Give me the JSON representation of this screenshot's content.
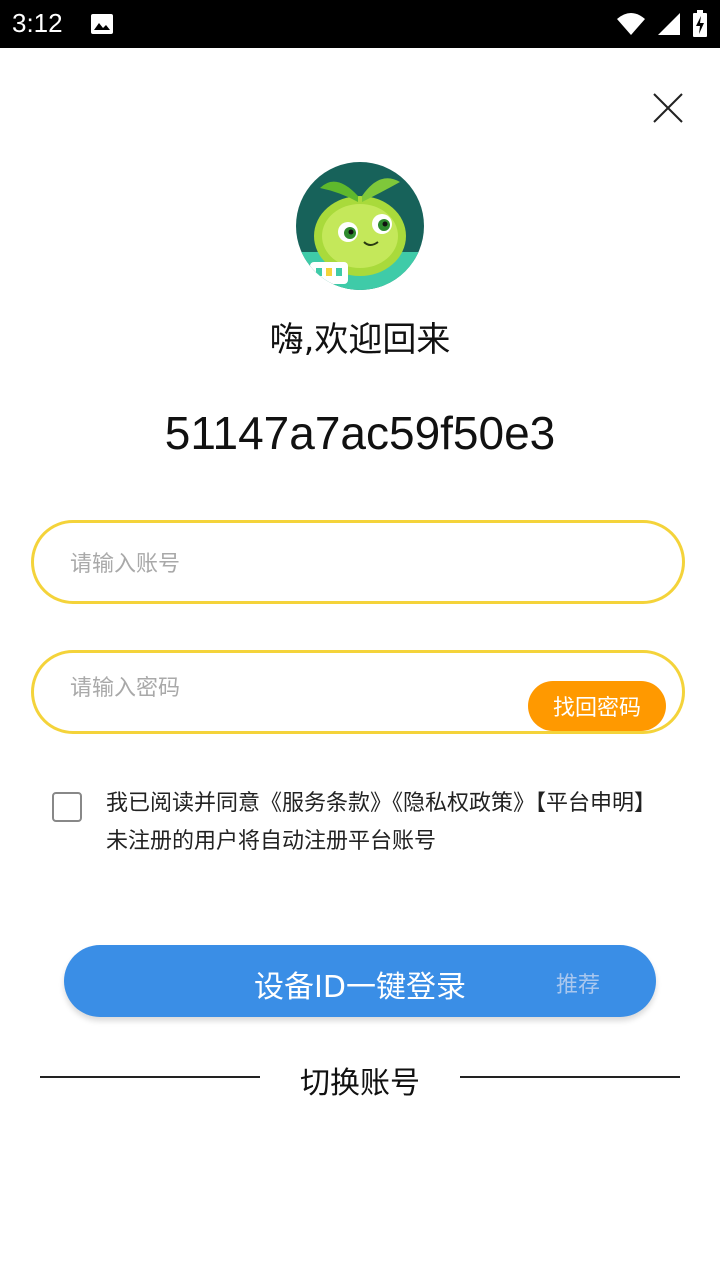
{
  "status_bar": {
    "time": "3:12"
  },
  "welcome": "嗨,欢迎回来",
  "device_id": "51147a7ac59f50e3",
  "account_field": {
    "placeholder": "请输入账号",
    "value": ""
  },
  "password_field": {
    "placeholder": "请输入密码",
    "value": ""
  },
  "find_password_label": "找回密码",
  "agreement_text": "我已阅读并同意《服务条款》《隐私权政策》【平台申明】未注册的用户将自动注册平台账号",
  "agreement_checked": false,
  "login_button": {
    "label": "设备ID一键登录",
    "badge": "推荐"
  },
  "switch_account_label": "切换账号",
  "colors": {
    "accent_yellow": "#f4d33a",
    "orange": "#ff9900",
    "primary_blue": "#3a8ee6"
  },
  "icons": [
    "image-icon",
    "wifi-icon",
    "signal-icon",
    "battery-icon",
    "close-icon",
    "avatar-mascot"
  ]
}
